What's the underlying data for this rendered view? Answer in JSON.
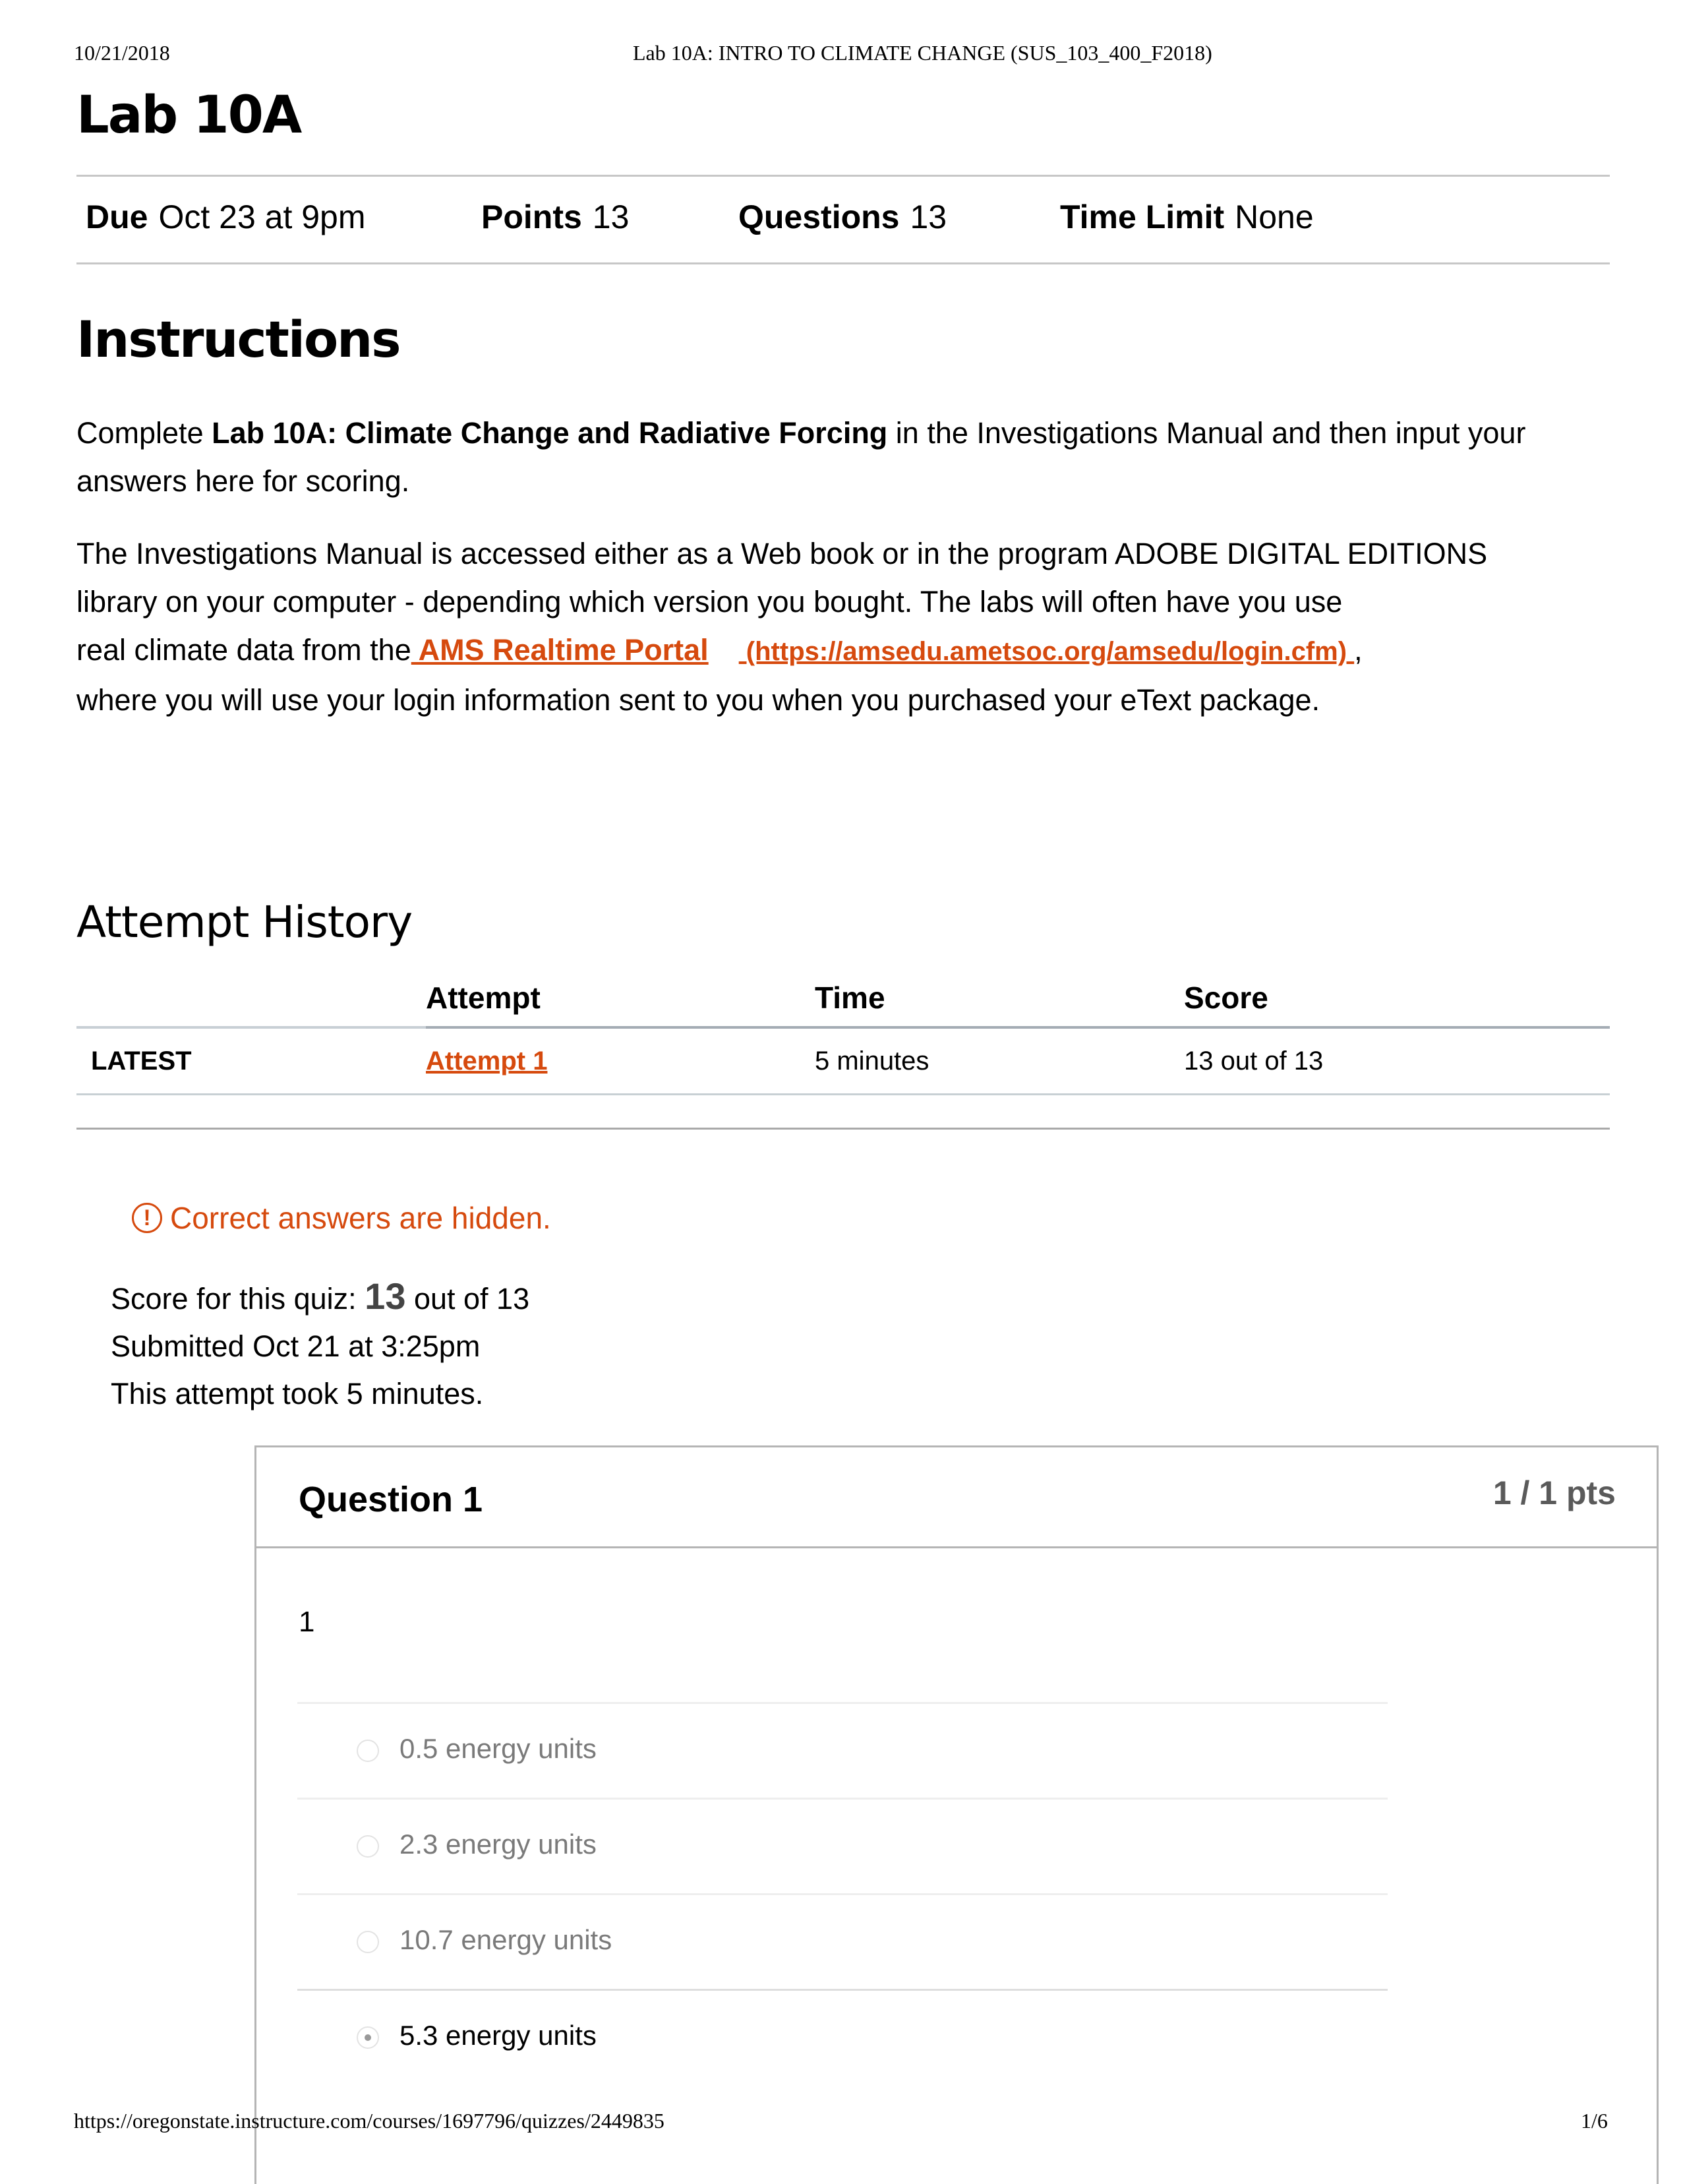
{
  "print_header": {
    "date": "10/21/2018",
    "doc_title": "Lab 10A: INTRO TO CLIMATE CHANGE (SUS_103_400_F2018)"
  },
  "print_footer": {
    "url": "https://oregonstate.instructure.com/courses/1697796/quizzes/2449835",
    "page": "1/6"
  },
  "quiz": {
    "title": "Lab 10A",
    "meta": [
      {
        "label": "Due",
        "value": "Oct 23 at 9pm"
      },
      {
        "label": "Points",
        "value": "13"
      },
      {
        "label": "Questions",
        "value": "13"
      },
      {
        "label": "Time Limit",
        "value": "None"
      }
    ]
  },
  "instructions": {
    "heading": "Instructions",
    "p1_pre": "Complete ",
    "p1_bold": "Lab 10A: Climate Change and Radiative Forcing",
    "p1_post": " in the Investigations Manual and then input your answers here for scoring.",
    "p2_line1": "The Investigations Manual is accessed either as a Web book or in the program ADOBE DIGITAL EDITIONS",
    "p2_line2": "library on your computer - depending which version you bought.  The labs will often have you use",
    "p2_line3_pre": "real climate data from the",
    "p2_link_label": " AMS Realtime Portal",
    "p2_link_url": " (https://amsedu.ametsoc.org/amsedu/login.cfm) ",
    "p2_line3_post": ",",
    "p2_line4": "where you will use your login information sent to you when you purchased your eText package."
  },
  "attempt_history": {
    "heading": "Attempt History",
    "columns": [
      "",
      "Attempt",
      "Time",
      "Score"
    ],
    "rows": [
      {
        "tag": "LATEST",
        "attempt": "Attempt 1 ",
        "time": "5 minutes",
        "score": "13 out of 13"
      }
    ]
  },
  "result": {
    "notice": "Correct answers are hidden.",
    "score_pre": "Score for this quiz: ",
    "score_value": "13",
    "score_post": " out of 13",
    "submitted": "Submitted Oct 21 at 3:25pm",
    "duration": "This attempt took 5 minutes."
  },
  "question": {
    "title": "Question 1",
    "points": "1 / 1 pts",
    "text": "1",
    "answers": [
      {
        "label": "0.5 energy units",
        "selected": false
      },
      {
        "label": "2.3 energy units",
        "selected": false
      },
      {
        "label": "10.7 energy units",
        "selected": false
      },
      {
        "label": "5.3 energy units",
        "selected": true
      }
    ]
  },
  "colors": {
    "accent": "#d64a0e",
    "muted_text": "#7a7a7a",
    "points_text": "#5a5a5a"
  }
}
